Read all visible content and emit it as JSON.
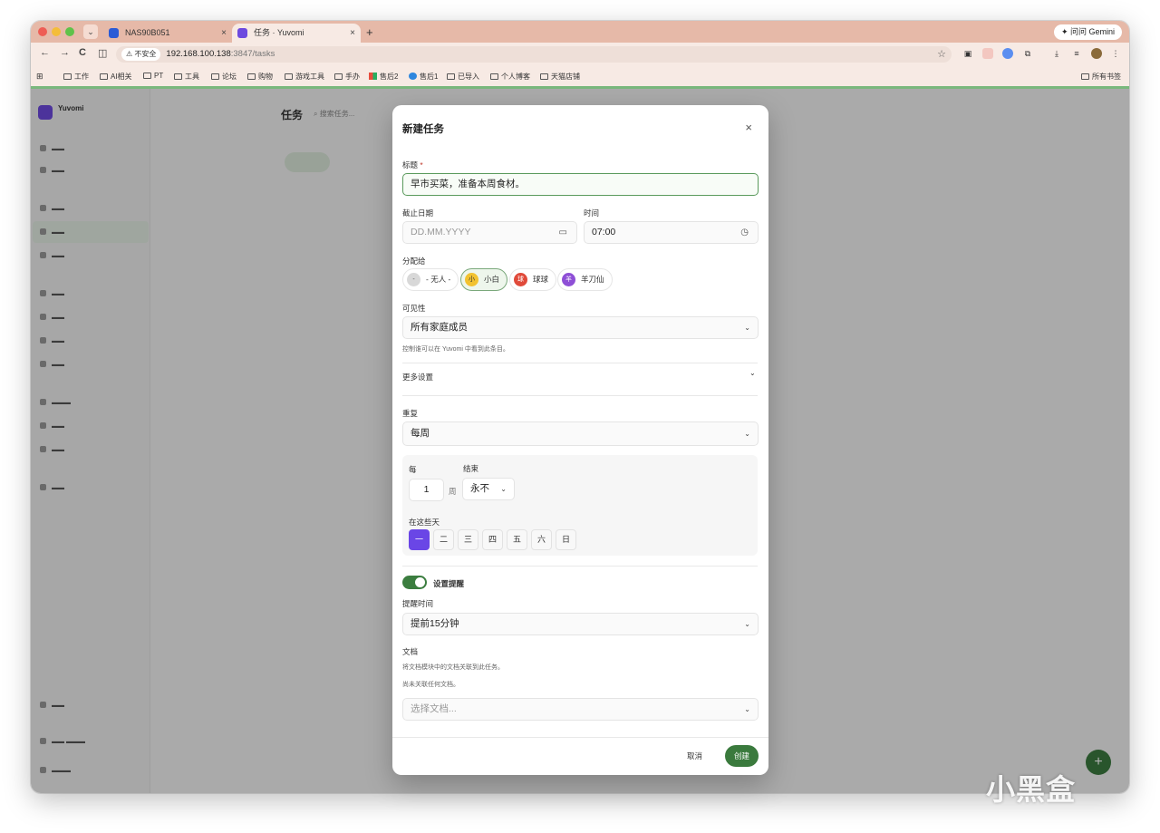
{
  "browser": {
    "tab_menu_icon": "chevron-down-icon",
    "tabs": [
      {
        "label": "NAS90B051",
        "close": "×"
      },
      {
        "label": "任务 · Yuvomi",
        "close": "×"
      }
    ],
    "new_tab": "+",
    "gemini_button": "问问 Gemini",
    "nav": {
      "back": "←",
      "forward": "→",
      "reload": "C",
      "sidepanel": "◫"
    },
    "address": {
      "security": "不安全",
      "host": "192.168.100.138",
      "path": ":3847/tasks"
    },
    "star": "☆",
    "bookmarks": [
      "工作",
      "AI相关",
      "PT",
      "工具",
      "论坛",
      "购物",
      "游戏工具",
      "手办",
      "售后2",
      "售后1",
      "已导入",
      "个人博客",
      "天猫店铺"
    ],
    "all_bookmarks": "所有书签"
  },
  "app": {
    "logo": "Yuvomi",
    "page_title": "任务",
    "search_placeholder": "搜索任务..."
  },
  "modal": {
    "title": "新建任务",
    "close": "×",
    "title_label": "标题",
    "required_mark": "*",
    "title_value": "早市买菜，准备本周食材。",
    "due_date_label": "截止日期",
    "due_date_placeholder": "DD.MM.YYYY",
    "time_label": "时间",
    "time_value": "07:00",
    "assign_label": "分配给",
    "assignees": [
      {
        "avatar": "-",
        "name": "- 无人 -",
        "color": "#d8d8d8"
      },
      {
        "avatar": "小",
        "name": "小白",
        "color": "#f2c230"
      },
      {
        "avatar": "球",
        "name": "球球",
        "color": "#e04a3a"
      },
      {
        "avatar": "羊",
        "name": "羊刀仙",
        "color": "#8e4fd6"
      }
    ],
    "selected_assignee": "小白",
    "visibility_label": "可见性",
    "visibility_value": "所有家庭成员",
    "visibility_hint": "控制谁可以在 Yuvomi 中看到此条目。",
    "more_settings": "更多设置",
    "repeat_label": "重复",
    "repeat_value": "每周",
    "every_label": "每",
    "every_value": "1",
    "every_unit": "周",
    "end_label": "结束",
    "end_value": "永不",
    "days_label": "在这些天",
    "days": [
      "一",
      "二",
      "三",
      "四",
      "五",
      "六",
      "日"
    ],
    "selected_day": "一",
    "reminder_toggle_label": "设置提醒",
    "reminder_time_label": "提醒时间",
    "reminder_value": "提前15分钟",
    "docs_label": "文档",
    "docs_hint1": "将文档模块中的文档关联到此任务。",
    "docs_hint2": "尚未关联任何文档。",
    "docs_placeholder": "选择文档...",
    "cancel": "取消",
    "create": "创建"
  },
  "fab": "+",
  "watermark": "小黑盒",
  "colors": {
    "accent_green": "#3a7a3d",
    "day_selected": "#6a46e6",
    "tab_strip": "#e6b9a8"
  }
}
